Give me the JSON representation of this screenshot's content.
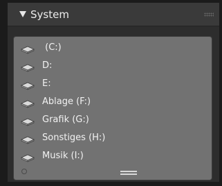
{
  "panel": {
    "title": "System"
  },
  "drives": [
    {
      "label": " (C:)",
      "icon": "drive-icon"
    },
    {
      "label": "D:",
      "icon": "drive-icon"
    },
    {
      "label": "E:",
      "icon": "drive-icon"
    },
    {
      "label": "Ablage (F:)",
      "icon": "drive-icon"
    },
    {
      "label": "Grafik (G:)",
      "icon": "drive-icon"
    },
    {
      "label": "Sonstiges (H:)",
      "icon": "drive-icon"
    },
    {
      "label": "Musik (I:)",
      "icon": "drive-icon"
    }
  ],
  "colors": {
    "header_bg": "#3a3a3a",
    "list_bg": "#727272",
    "text": "#f2f2f2"
  }
}
